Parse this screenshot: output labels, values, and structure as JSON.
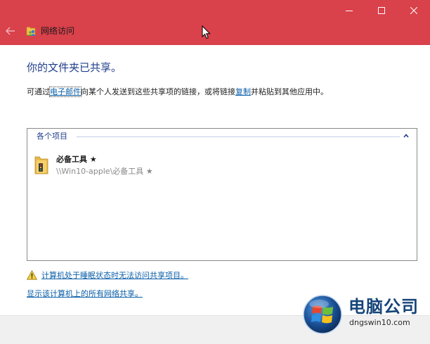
{
  "window": {
    "title": "网络访问",
    "accent_color": "#d9414b",
    "controls": [
      "minimize-icon",
      "maximize-icon",
      "close-icon"
    ]
  },
  "main": {
    "heading": "你的文件夹已共享。",
    "desc_before": "可通过",
    "email_link": "电子邮件",
    "desc_middle": "向某个人发送到这些共享项的链接，或将链接",
    "copy_link": "复制",
    "desc_after": "并粘贴到其他应用中。"
  },
  "list": {
    "group_header": "各个项目",
    "items": [
      {
        "name": "必备工具 ★",
        "path": "\\\\Win10-apple\\必备工具 ★",
        "icon": "folder-icon"
      }
    ]
  },
  "links": {
    "sleep_warning": "计算机处于睡眠状态时无法访问共享项目。",
    "show_all": "显示该计算机上的所有网络共享。"
  },
  "watermark": {
    "brand": "电脑公司",
    "url": "dngswin10.com"
  }
}
